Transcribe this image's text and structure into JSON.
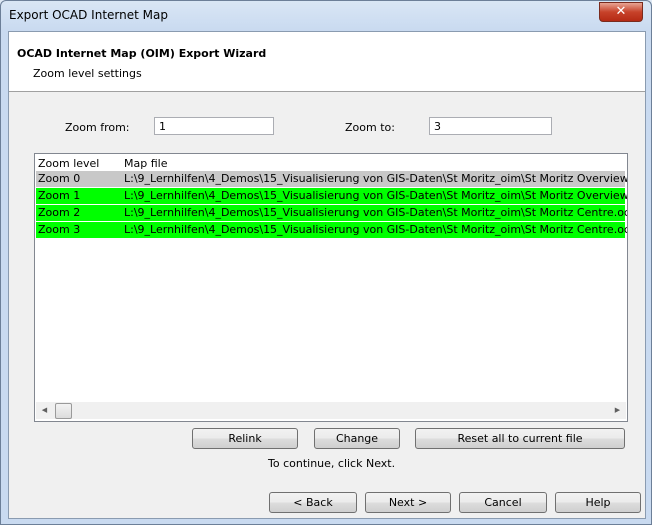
{
  "window": {
    "title": "Export OCAD Internet Map",
    "close_label": "✕"
  },
  "header": {
    "title": "OCAD Internet Map (OIM) Export Wizard",
    "subtitle": "Zoom level settings"
  },
  "zoom": {
    "from_label": "Zoom from:",
    "from_value": "1",
    "to_label": "Zoom to:",
    "to_value": "3"
  },
  "list": {
    "columns": [
      "Zoom level",
      "Map file"
    ],
    "rows": [
      {
        "level": "Zoom 0",
        "file": "L:\\9_Lernhilfen\\4_Demos\\15_Visualisierung von GIS-Daten\\St Moritz_oim\\St Moritz Overview.ocd",
        "highlight": "selected"
      },
      {
        "level": "Zoom 1",
        "file": "L:\\9_Lernhilfen\\4_Demos\\15_Visualisierung von GIS-Daten\\St Moritz_oim\\St Moritz Overview.ocd",
        "highlight": "green"
      },
      {
        "level": "Zoom 2",
        "file": "L:\\9_Lernhilfen\\4_Demos\\15_Visualisierung von GIS-Daten\\St Moritz_oim\\St Moritz Centre.ocd",
        "highlight": "green"
      },
      {
        "level": "Zoom 3",
        "file": "L:\\9_Lernhilfen\\4_Demos\\15_Visualisierung von GIS-Daten\\St Moritz_oim\\St Moritz Centre.ocd",
        "highlight": "green"
      }
    ],
    "scroll_left_icon": "◀",
    "scroll_right_icon": "▶"
  },
  "actions": {
    "relink": "Relink",
    "change": "Change",
    "reset": "Reset all to current file"
  },
  "hint": "To continue, click Next.",
  "nav": {
    "back": "< Back",
    "next": "Next >",
    "cancel": "Cancel",
    "help": "Help"
  },
  "colors": {
    "selected_row": "#c8c8c8",
    "highlight_row": "#00ff00"
  }
}
